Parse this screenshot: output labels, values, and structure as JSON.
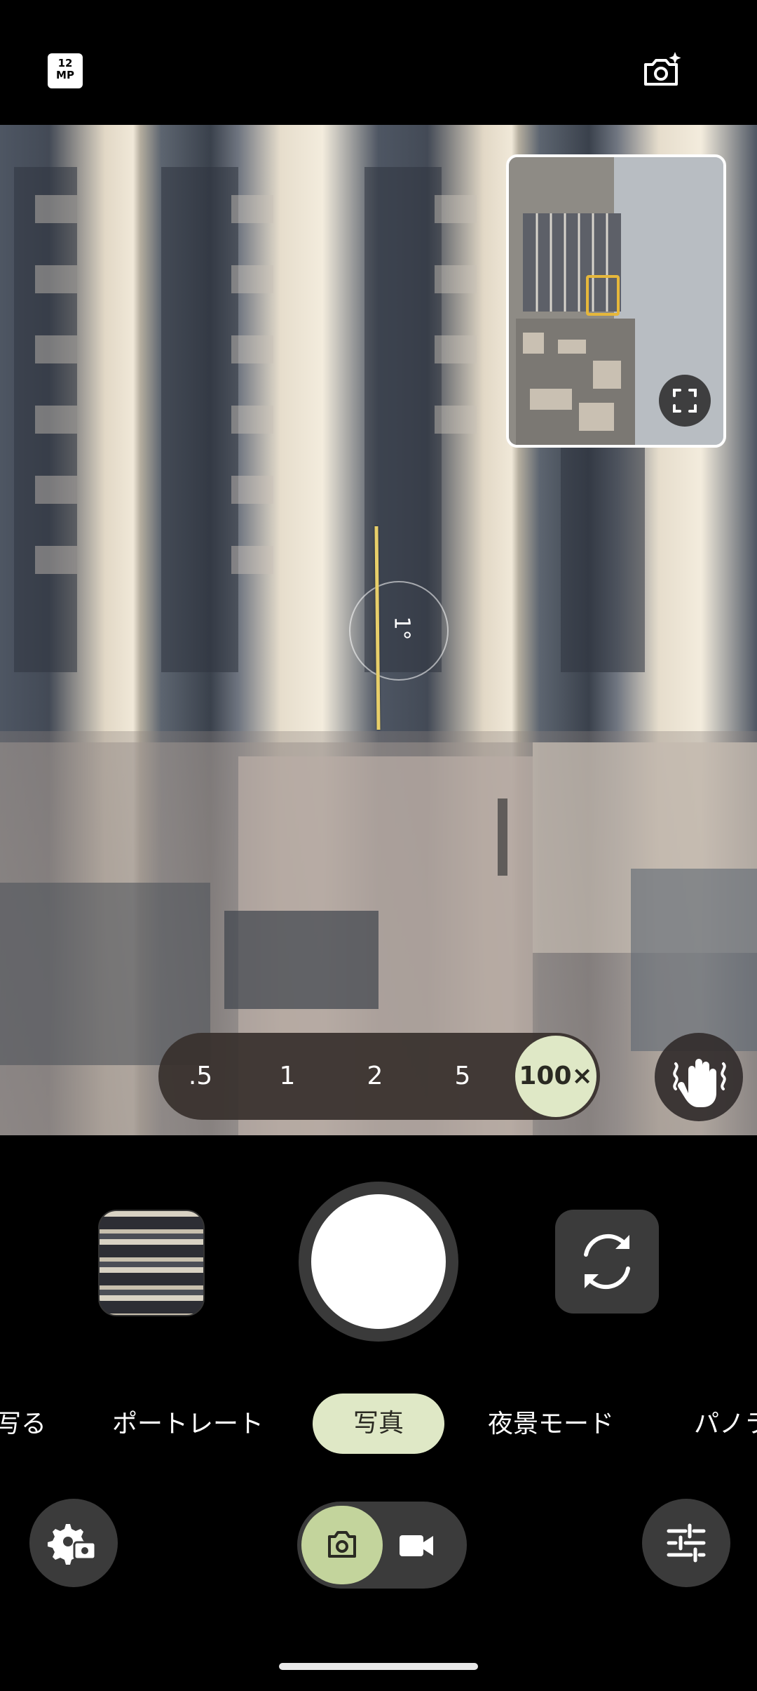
{
  "top_bar": {
    "resolution_icon": {
      "line1": "12",
      "line2": "MP"
    },
    "icons": [
      "resolution-icon",
      "camera-sparkle-icon"
    ]
  },
  "viewfinder": {
    "level_degree": "1°"
  },
  "minimap": {
    "icons": [
      "expand-icon"
    ]
  },
  "zoom": {
    "options": [
      ".5",
      "1",
      "2",
      "5"
    ],
    "selected": "100×"
  },
  "modes": {
    "items": [
      "写る",
      "ポートレート",
      "写真",
      "夜景モード",
      "パノラ"
    ],
    "selected": "写真"
  },
  "bottom_row": {
    "icons": [
      "settings-camera-icon",
      "camera-icon",
      "video-icon",
      "sliders-icon"
    ]
  },
  "colors": {
    "accent": "#dfe8c6",
    "toggle_active": "#c3d49c",
    "focus_box": "#e6b73b",
    "level_line": "#e8cf6a"
  }
}
